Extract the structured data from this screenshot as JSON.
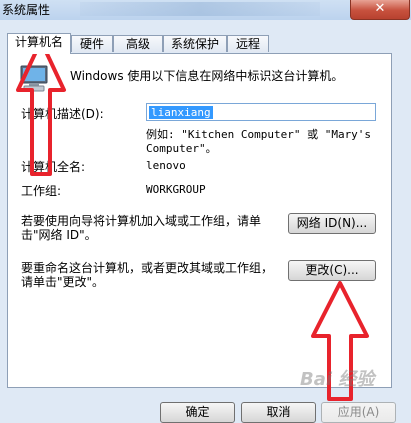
{
  "window": {
    "title": "系统属性",
    "close_glyph": "✕"
  },
  "tabs": [
    {
      "label": "计算机名",
      "active": true
    },
    {
      "label": "硬件",
      "active": false
    },
    {
      "label": "高级",
      "active": false
    },
    {
      "label": "系统保护",
      "active": false
    },
    {
      "label": "远程",
      "active": false
    }
  ],
  "info_text": "Windows 使用以下信息在网络中标识这台计算机。",
  "description": {
    "label": "计算机描述(D):",
    "value": "lianxiang",
    "example": "例如: \"Kitchen Computer\" 或 \"Mary's Computer\"。"
  },
  "full_name": {
    "label": "计算机全名:",
    "value": "lenovo"
  },
  "workgroup": {
    "label": "工作组:",
    "value": "WORKGROUP"
  },
  "network_id": {
    "text_line1": "若要使用向导将计算机加入域或工作组，请单",
    "text_line2": "击\"网络 ID\"。",
    "button": "网络 ID(N)..."
  },
  "rename": {
    "text_line1": "要重命名这台计算机，或者更改其域或工作组，",
    "text_line2": "请单击\"更改\"。",
    "button": "更改(C)..."
  },
  "footer": {
    "ok": "确定",
    "cancel": "取消",
    "apply": "应用(A)"
  },
  "watermark": "Bai 经验",
  "colors": {
    "annotation_arrow": "#e8232c",
    "window_frame": "#dfe9f5",
    "selection": "#3399ff"
  }
}
